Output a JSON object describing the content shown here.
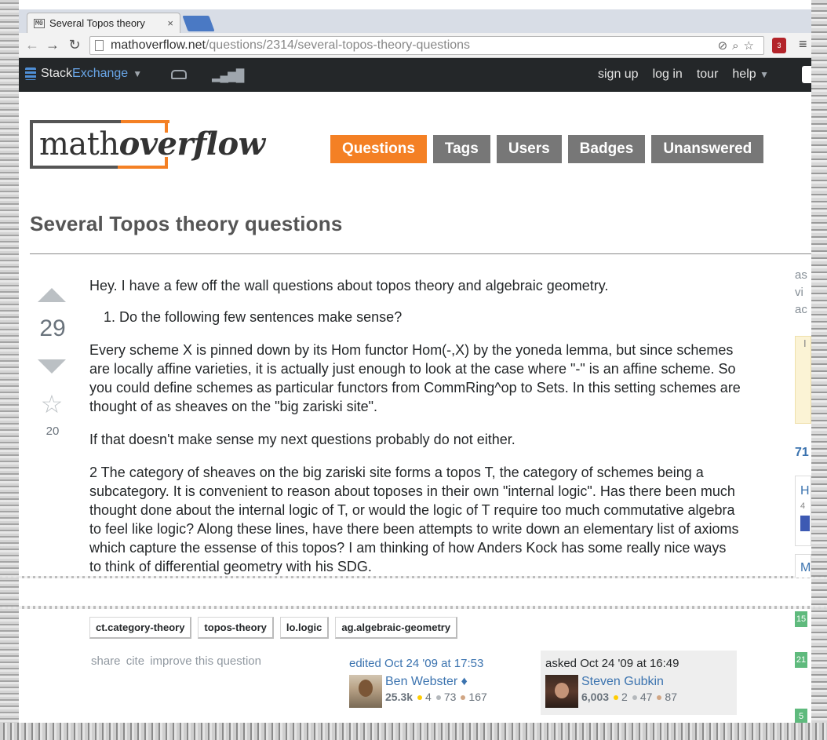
{
  "browser": {
    "tab_title": "Several Topos theory",
    "tab_favicon": "M0",
    "url_host": "mathoverflow.net",
    "url_path": "/questions/2314/several-topos-theory-questions",
    "ext_badge": "3"
  },
  "topbar": {
    "brand_stack": "Stack",
    "brand_exchange": "Exchange",
    "links": [
      "sign up",
      "log in",
      "tour",
      "help"
    ]
  },
  "site": {
    "logo_math": "math",
    "logo_overflow": "overflow",
    "nav": [
      {
        "label": "Questions",
        "active": true
      },
      {
        "label": "Tags",
        "active": false
      },
      {
        "label": "Users",
        "active": false
      },
      {
        "label": "Badges",
        "active": false
      },
      {
        "label": "Unanswered",
        "active": false
      }
    ]
  },
  "question": {
    "title": "Several Topos theory questions",
    "votes": "29",
    "favorites": "20",
    "para1": "Hey. I have a few off the wall questions about topos theory and algebraic geometry.",
    "list_item1": "Do the following few sentences make sense?",
    "para2": "Every scheme X is pinned down by its Hom functor Hom(-,X) by the yoneda lemma, but since schemes are locally affine varieties, it is actually just enough to look at the case where \"-\" is an affine scheme. So you could define schemes as particular functors from CommRing^op to Sets. In this setting schemes are thought of as sheaves on the \"big zariski site\".",
    "para3": "If that doesn't make sense my next questions probably do not either.",
    "para4": "2 The category of sheaves on the big zariski site forms a topos T, the category of schemes being a subcategory. It is convenient to reason about toposes in their own \"internal logic\". Has there been much thought done about the internal logic of T, or would the logic of T require too much commutative algebra to feel like logic? Along these lines, have there been attempts to write down an elementary list of axioms which capture the essense of this topos? I am thinking of how Anders Kock has some really nice ways to think of differential geometry with his SDG.",
    "tags": [
      "ct.category-theory",
      "topos-theory",
      "lo.logic",
      "ag.algebraic-geometry"
    ],
    "menu": [
      "share",
      "cite",
      "improve this question"
    ]
  },
  "editor": {
    "when": "edited Oct 24 '09 at 17:53",
    "name": "Ben Webster",
    "mod": "♦",
    "rep": "25.3k",
    "gold": "4",
    "silver": "73",
    "bronze": "167"
  },
  "owner": {
    "when": "asked Oct 24 '09 at 16:49",
    "name": "Steven Gubkin",
    "rep": "6,003",
    "gold": "2",
    "silver": "47",
    "bronze": "87"
  },
  "sidebar": {
    "stats_fragments": [
      "as",
      "vi",
      "ac"
    ],
    "yellow_fragment": "I",
    "linked_count": "71",
    "card1_fragment": "H",
    "card1_sub": "4",
    "card2_fragment": "M",
    "green_scores": [
      "15",
      "21",
      "5"
    ]
  },
  "colors": {
    "accent": "#f48024",
    "nav_gray": "#777777",
    "link": "#3b73af",
    "topbar": "#242729"
  }
}
